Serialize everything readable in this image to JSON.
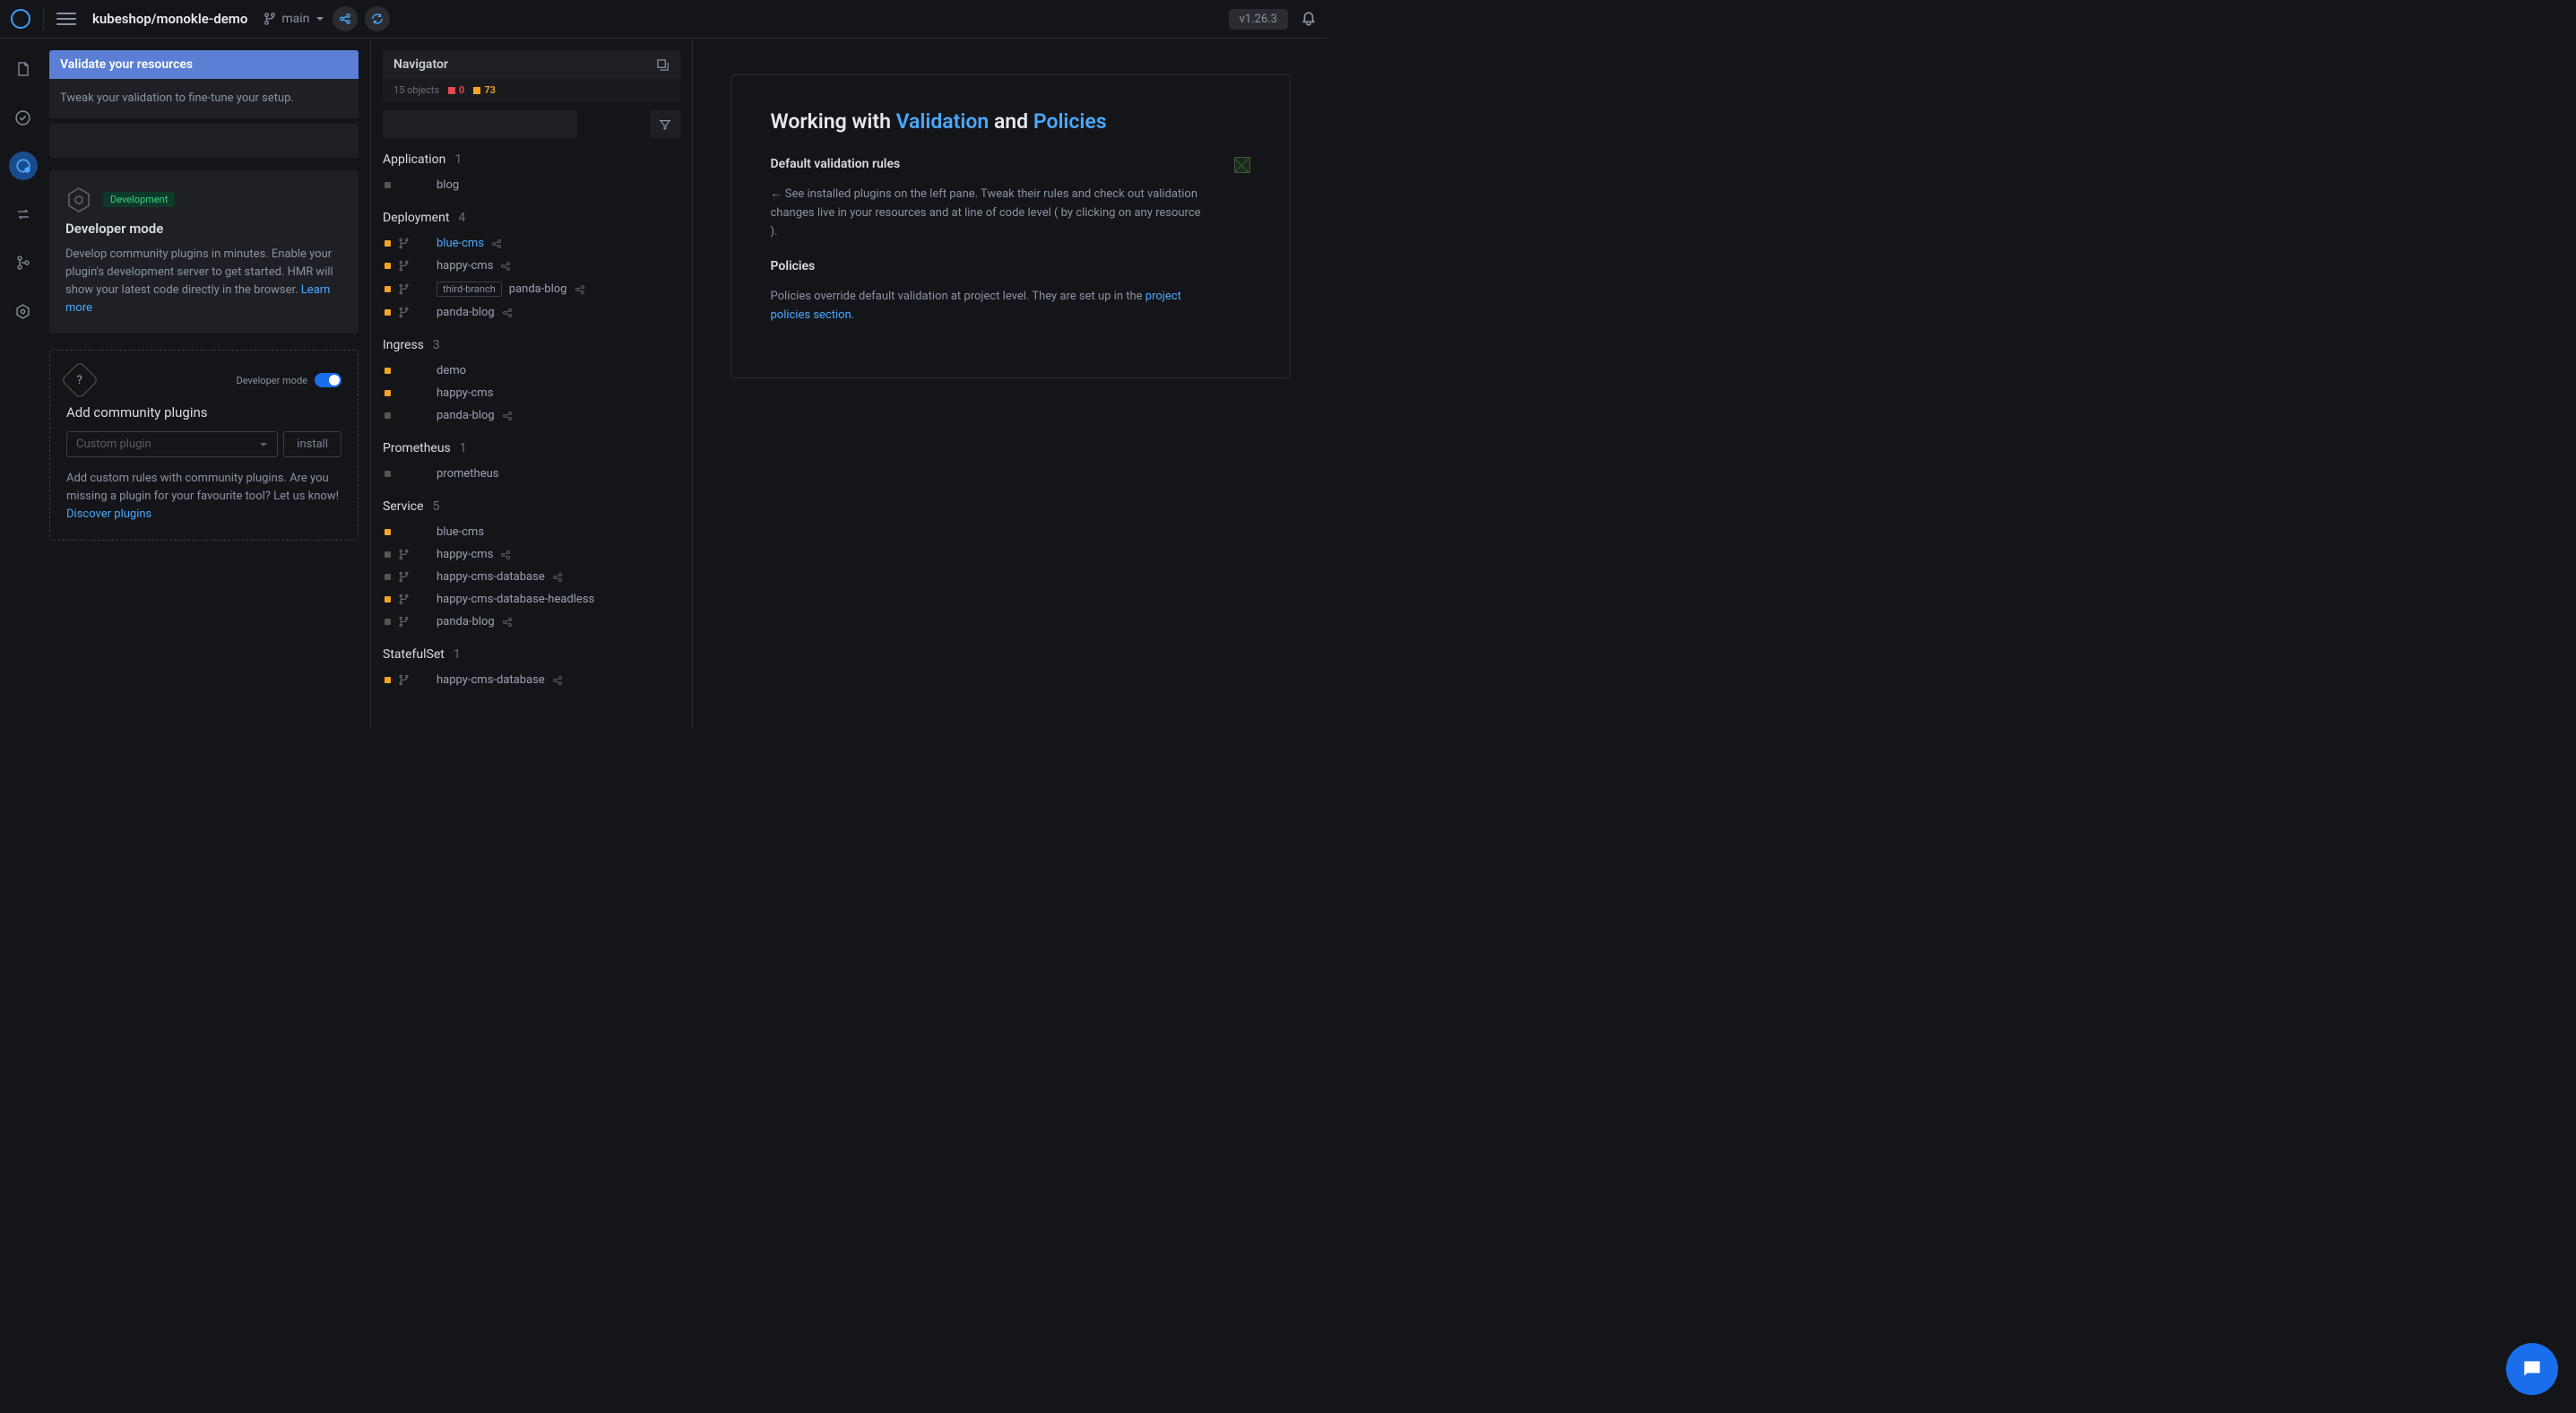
{
  "header": {
    "project": "kubeshop/monokle-demo",
    "branch": "main",
    "version": "v1.26.3"
  },
  "sidebar": {
    "validate_title": "Validate your resources",
    "tweak_text": "Tweak your validation to fine-tune your setup.",
    "dev": {
      "tag": "Development",
      "title": "Developer mode",
      "desc": "Develop community plugins in minutes. Enable your plugin's development server to get started. HMR will show your latest code directly in the browser.",
      "learn": "Learn more"
    },
    "community": {
      "toggle_label": "Developer mode",
      "title": "Add community plugins",
      "select_placeholder": "Custom plugin",
      "install": "install",
      "desc": "Add custom rules with community plugins. Are you missing a plugin for your favourite tool? Let us know!",
      "discover": "Discover plugins"
    }
  },
  "navigator": {
    "title": "Navigator",
    "objects": "15 objects",
    "red": "0",
    "yellow": "73",
    "groups": [
      {
        "name": "Application",
        "count": "1",
        "items": [
          {
            "name": "blog",
            "dot": "g",
            "branch": false,
            "share": false
          }
        ]
      },
      {
        "name": "Deployment",
        "count": "4",
        "items": [
          {
            "name": "blue-cms",
            "dot": "y",
            "branch": true,
            "share": true,
            "blue": true
          },
          {
            "name": "happy-cms",
            "dot": "y",
            "branch": true,
            "share": true
          },
          {
            "name": "panda-blog",
            "dot": "y",
            "branch": true,
            "share": true,
            "tag": "third-branch"
          },
          {
            "name": "panda-blog",
            "dot": "y",
            "branch": true,
            "share": true
          }
        ]
      },
      {
        "name": "Ingress",
        "count": "3",
        "items": [
          {
            "name": "demo",
            "dot": "y",
            "branch": false,
            "share": false
          },
          {
            "name": "happy-cms",
            "dot": "y",
            "branch": false,
            "share": false
          },
          {
            "name": "panda-blog",
            "dot": "g",
            "branch": false,
            "share": true
          }
        ]
      },
      {
        "name": "Prometheus",
        "count": "1",
        "items": [
          {
            "name": "prometheus",
            "dot": "g",
            "branch": false,
            "share": false
          }
        ]
      },
      {
        "name": "Service",
        "count": "5",
        "items": [
          {
            "name": "blue-cms",
            "dot": "y",
            "branch": false,
            "share": false
          },
          {
            "name": "happy-cms",
            "dot": "g",
            "branch": true,
            "share": true
          },
          {
            "name": "happy-cms-database",
            "dot": "g",
            "branch": true,
            "share": true
          },
          {
            "name": "happy-cms-database-headless",
            "dot": "y",
            "branch": true,
            "share": false
          },
          {
            "name": "panda-blog",
            "dot": "g",
            "branch": true,
            "share": true
          }
        ]
      },
      {
        "name": "StatefulSet",
        "count": "1",
        "items": [
          {
            "name": "happy-cms-database",
            "dot": "y",
            "branch": true,
            "share": true
          }
        ]
      }
    ]
  },
  "content": {
    "t1": "Working with ",
    "t2": "Validation",
    "t3": " and ",
    "t4": "Policies",
    "s1_h": "Default validation rules",
    "s1_p": "← See installed plugins on the left pane. Tweak their rules and check out validation changes live in your resources and at line of code level ( by clicking on any resource ).",
    "s2_h": "Policies",
    "s2_p": "Policies override default validation at project level. They are set up in the ",
    "s2_link": "project policies section."
  }
}
